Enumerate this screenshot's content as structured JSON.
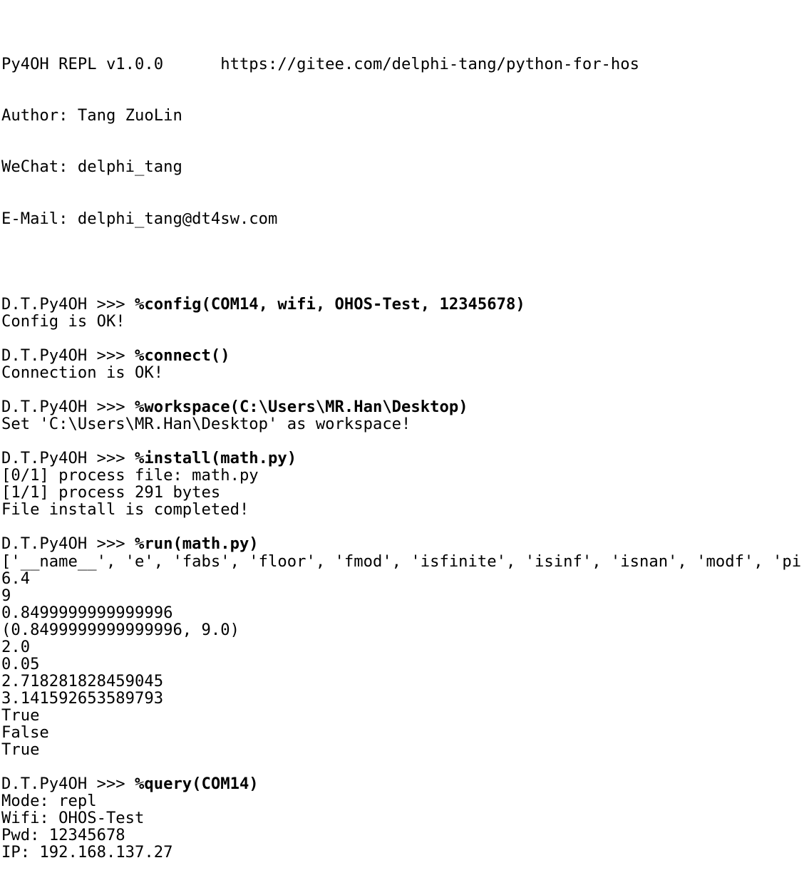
{
  "app": {
    "title": "Py4OH REPL v1.0.0",
    "name": "Py4OH REPL",
    "version": "v1.0.0",
    "url": "https://gitee.com/delphi-tang/python-for-hos",
    "prompt": "D.T.Py4OH >>> ",
    "background_color": "#ffffff",
    "text_color": "#000000"
  },
  "banner": {
    "header_line": "Py4OH REPL v1.0.0      https://gitee.com/delphi-tang/python-for-hos",
    "author": "Author: Tang ZuoLin",
    "wechat": "WeChat: delphi_tang",
    "email": "E-Mail: delphi_tang@dt4sw.com"
  },
  "session": {
    "blocks": [
      {
        "id": "config",
        "prompt": "D.T.Py4OH >>> ",
        "command": "%config(COM14, wifi, OHOS-Test, 12345678)",
        "output": [
          "Config is OK!"
        ]
      },
      {
        "id": "connect",
        "prompt": "D.T.Py4OH >>> ",
        "command": "%connect()",
        "output": [
          "Connection is OK!"
        ]
      },
      {
        "id": "workspace",
        "prompt": "D.T.Py4OH >>> ",
        "command": "%workspace(C:\\Users\\MR.Han\\Desktop)",
        "output": [
          "Set 'C:\\Users\\MR.Han\\Desktop' as workspace!"
        ]
      },
      {
        "id": "install",
        "prompt": "D.T.Py4OH >>> ",
        "command": "%install(math.py)",
        "output": [
          "[0/1] process file: math.py",
          "[1/1] process 291 bytes",
          "File install is completed!"
        ]
      },
      {
        "id": "run",
        "prompt": "D.T.Py4OH >>> ",
        "command": "%run(math.py)",
        "output": [
          "['__name__', 'e', 'fabs', 'floor', 'fmod', 'isfinite', 'isinf', 'isnan', 'modf', 'pi']",
          "6.4",
          "9",
          "0.8499999999999996",
          "(0.8499999999999996, 9.0)",
          "2.0",
          "0.05",
          "2.718281828459045",
          "3.141592653589793",
          "True",
          "False",
          "True"
        ]
      },
      {
        "id": "query",
        "prompt": "D.T.Py4OH >>> ",
        "command": "%query(COM14)",
        "output": [
          "Mode: repl",
          "Wifi: OHOS-Test",
          "Pwd: 12345678",
          "IP: 192.168.137.27"
        ]
      }
    ]
  }
}
